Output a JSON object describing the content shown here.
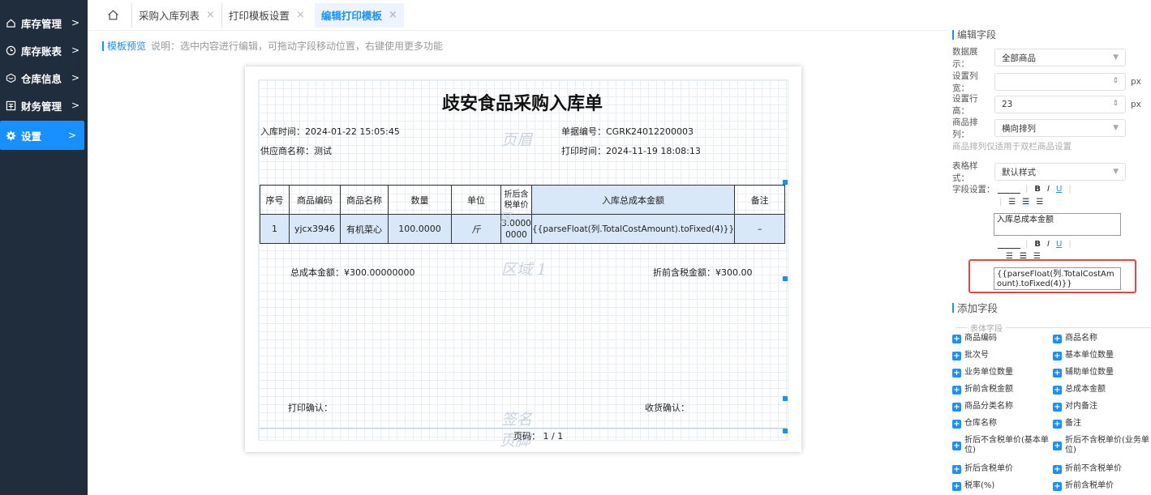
{
  "sidebar": {
    "items": [
      {
        "label": "库存管理",
        "icon": "home-icon"
      },
      {
        "label": "库存账表",
        "icon": "clock-icon"
      },
      {
        "label": "仓库信息",
        "icon": "box-icon"
      },
      {
        "label": "财务管理",
        "icon": "ledger-icon"
      },
      {
        "label": "设置",
        "icon": "gear-icon"
      }
    ],
    "arrow": ">"
  },
  "tabs": [
    {
      "label": "采购入库列表"
    },
    {
      "label": "打印模板设置"
    },
    {
      "label": "编辑打印模板"
    }
  ],
  "tab_close": "×",
  "preview": {
    "label": "模板预览",
    "hint": "说明：选中内容进行编辑，可拖动字段移动位置，右键使用更多功能"
  },
  "doc": {
    "title": "歧安食品采购入库单",
    "in_time": "入库时间：2024-01-22 15:05:45",
    "doc_no": "单据编号：CGRK24012200003",
    "supplier": "供应商名称：测试",
    "print_time": "打印时间：2024-11-19 18:08:13",
    "watermarks": {
      "header": "页眉",
      "area": "区",
      "area1": "区域 1",
      "sign": "签名",
      "footer": "页脚"
    },
    "table": {
      "headers": [
        "序号",
        "商品编码",
        "商品名称",
        "数量",
        "单位",
        "折后含税单价",
        "入库总成本金额",
        "备注"
      ],
      "row": [
        "1",
        "yjcx3946",
        "有机菜心",
        "100.0000",
        "斤",
        "3.0000 0000",
        "{{parseFloat(列.TotalCostAmount).toFixed(4)}}",
        "–"
      ]
    },
    "total_cost": "总成本金额：¥300.00000000",
    "total_tax": "折前含税金额：¥300.00",
    "print_confirm": "打印确认：",
    "receive_confirm": "收货确认：",
    "page_no": "页码： 1 / 1"
  },
  "panel": {
    "edit_title": "编辑字段",
    "data_show_label": "数据展示：",
    "data_show_value": "全部商品",
    "col_width_label": "设置列宽：",
    "col_width_value": "",
    "row_height_label": "设置行高：",
    "row_height_value": "23",
    "unit": "px",
    "arrange_label": "商品排列：",
    "arrange_value": "横向排列",
    "arrange_note": "商品排列仅适用于双栏商品设置",
    "table_style_label": "表格样式：",
    "table_style_value": "默认样式",
    "field_setting_label": "字段设置：",
    "bold": "B",
    "italic": "I",
    "underline": "U",
    "field1_text": "入库总成本金额",
    "field2_text": "{{parseFloat(列.TotalCostAmount).toFixed(4)}}",
    "add_title": "添加字段",
    "divider": "表体字段",
    "add_fields": [
      [
        "商品编码",
        "商品名称"
      ],
      [
        "批次号",
        "基本单位数量"
      ],
      [
        "业务单位数量",
        "辅助单位数量"
      ],
      [
        "折前含税金额",
        "总成本金额"
      ],
      [
        "商品分类名称",
        "对内备注"
      ],
      [
        "仓库名称",
        "备注"
      ],
      [
        "折后不含税单价(基本单位)",
        "折后不含税单价(业务单位)"
      ],
      [
        "折后含税单价",
        "折前不含税单价"
      ],
      [
        "税率(%)",
        "折前含税单价"
      ]
    ]
  },
  "colors": {
    "sidebar": "#1f2d3d",
    "accent": "#1890ff",
    "highlight": "#d8e8f8",
    "red_box": "#e64545"
  }
}
